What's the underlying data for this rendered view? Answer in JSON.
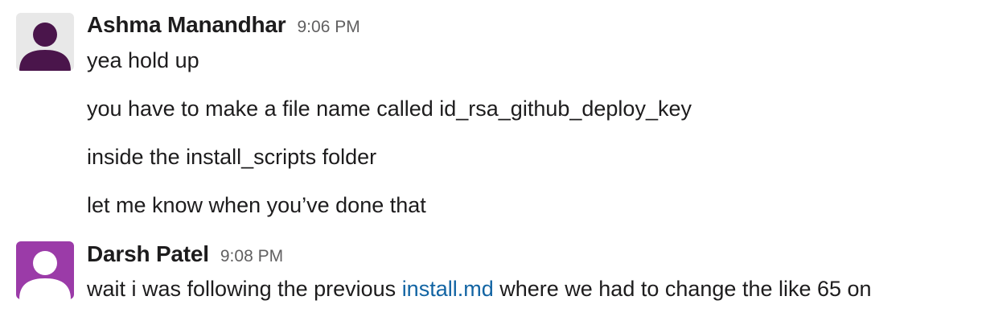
{
  "messages": [
    {
      "sender": "Ashma Manandhar",
      "time": "9:06 PM",
      "avatar_color": "#4a154b",
      "avatar_bg": "#e8e8e8",
      "lines": [
        "yea hold up",
        "you have to make a file name called id_rsa_github_deploy_key",
        "inside the install_scripts folder",
        "let me know when you’ve done that"
      ]
    },
    {
      "sender": "Darsh Patel",
      "time": "9:08 PM",
      "avatar_color": "#9b3ba8",
      "avatar_bg": "#ffffff",
      "text_before_link": "wait i was following the previous ",
      "link_text": "install.md",
      "text_after_link": " where we had to change the like 65 on"
    }
  ],
  "colors": {
    "link": "#1264a3",
    "timestamp": "#616061",
    "text": "#1d1c1d"
  }
}
